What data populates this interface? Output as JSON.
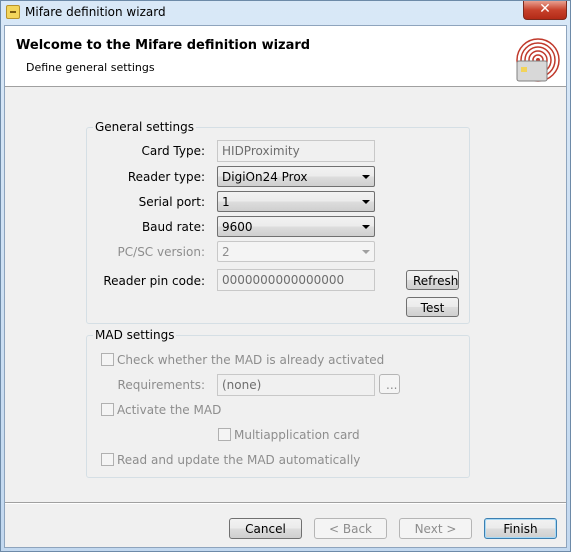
{
  "window": {
    "title": "Mifare definition wizard",
    "close_glyph": "✕"
  },
  "header": {
    "title": "Welcome to the Mifare definition wizard",
    "subtitle": "Define general settings",
    "logo_icon": "rfid-card-icon"
  },
  "general": {
    "legend": "General settings",
    "card_type_label": "Card Type:",
    "card_type_value": "HIDProximity",
    "reader_type_label": "Reader type:",
    "reader_type_value": "DigiOn24 Prox",
    "serial_port_label": "Serial port:",
    "serial_port_value": "1",
    "baud_rate_label": "Baud rate:",
    "baud_rate_value": "9600",
    "pcsc_label": "PC/SC version:",
    "pcsc_value": "2",
    "pin_label": "Reader pin code:",
    "pin_value": "0000000000000000",
    "refresh_label": "Refresh",
    "test_label": "Test"
  },
  "mad": {
    "legend": "MAD settings",
    "check_activated_label": "Check whether the MAD is already activated",
    "requirements_label": "Requirements:",
    "requirements_value": "(none)",
    "browse_label": "...",
    "activate_label": "Activate the MAD",
    "multiapp_label": "Multiapplication card",
    "read_update_label": "Read and update the MAD automatically"
  },
  "footer": {
    "cancel_label": "Cancel",
    "back_label": "< Back",
    "next_label": "Next >",
    "finish_label": "Finish"
  },
  "colors": {
    "accent": "#c0392b",
    "titlebar": "#cfe0f2"
  }
}
